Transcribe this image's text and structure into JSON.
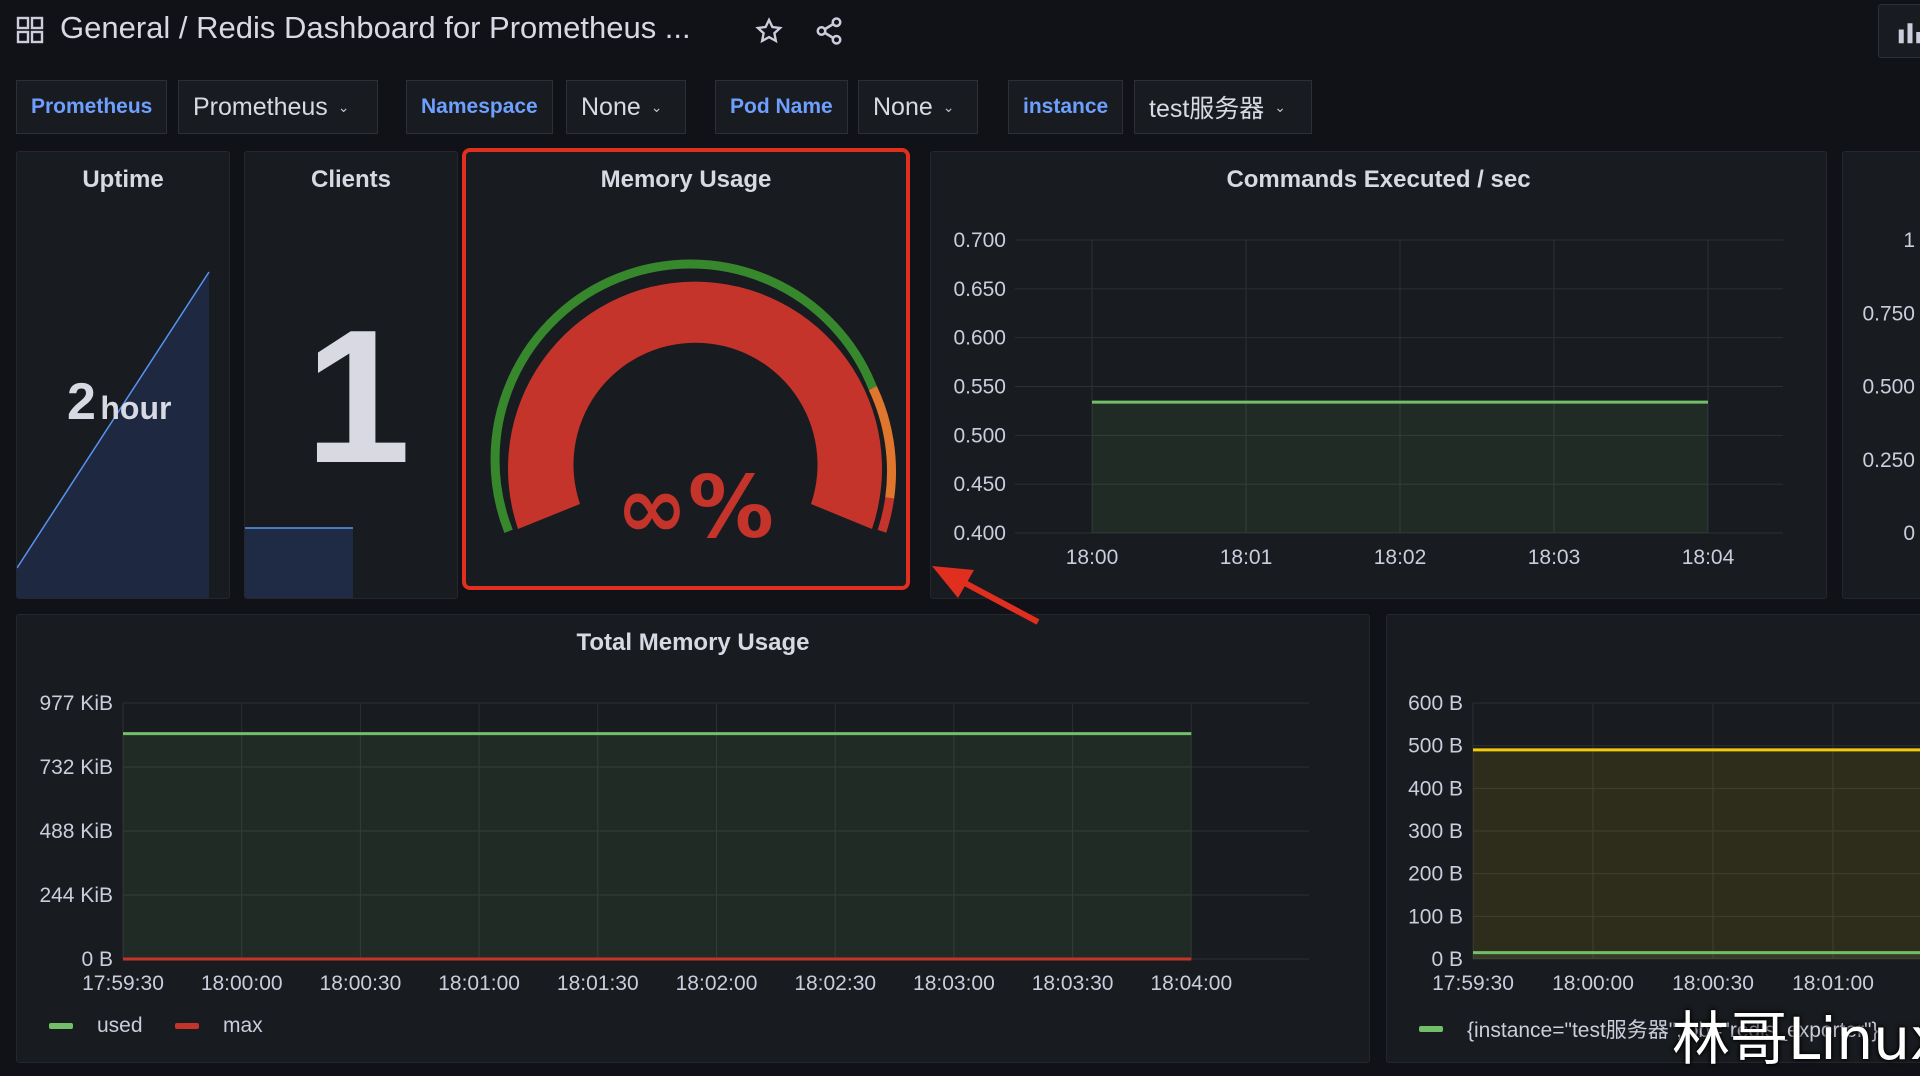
{
  "topbar": {
    "breadcrumb": "General  / Redis Dashboard for Prometheus ...",
    "icons": [
      "grid-icon",
      "star-icon",
      "share-icon",
      "panel-add-icon"
    ]
  },
  "variables": [
    {
      "label": "Prometheus",
      "value": "Prometheus"
    },
    {
      "label": "Namespace",
      "value": "None"
    },
    {
      "label": "Pod Name",
      "value": "None"
    },
    {
      "label": "instance",
      "value": "test服务器"
    }
  ],
  "uptime": {
    "title": "Uptime",
    "value": "2",
    "unit": "hour"
  },
  "clients": {
    "title": "Clients",
    "value": "1"
  },
  "memory_usage": {
    "title": "Memory Usage",
    "value": "∞%",
    "colors": {
      "track_green": "#37872d",
      "fill_red": "#c4342b",
      "orange": "#e0752d",
      "highlight": "#e02f1f"
    }
  },
  "commands": {
    "title": "Commands Executed / sec",
    "chart_data": {
      "type": "line",
      "x": [
        "18:00",
        "18:01",
        "18:02",
        "18:03",
        "18:04"
      ],
      "y_ticks": [
        "0.700",
        "0.650",
        "0.600",
        "0.550",
        "0.500",
        "0.450",
        "0.400"
      ],
      "ylim": [
        0.4,
        0.7
      ],
      "series": [
        {
          "values": [
            0.534,
            0.534,
            0.534,
            0.534,
            0.534
          ],
          "color": "#73bf69"
        }
      ]
    }
  },
  "right_partial": {
    "y_ticks": [
      "1",
      "0.750",
      "0.500",
      "0.250",
      "0"
    ]
  },
  "total_memory": {
    "title": "Total Memory Usage",
    "chart_data": {
      "type": "line",
      "x": [
        "17:59:30",
        "18:00:00",
        "18:00:30",
        "18:01:00",
        "18:01:30",
        "18:02:00",
        "18:02:30",
        "18:03:00",
        "18:03:30",
        "18:04:00"
      ],
      "y_ticks": [
        "977 KiB",
        "732 KiB",
        "488 KiB",
        "244 KiB",
        "0 B"
      ],
      "ylim": [
        0,
        977
      ],
      "series": [
        {
          "name": "used",
          "values": [
            860,
            860,
            860,
            860,
            860,
            860,
            860,
            860,
            860,
            860
          ],
          "color": "#73bf69"
        },
        {
          "name": "max",
          "values": [
            0,
            0,
            0,
            0,
            0,
            0,
            0,
            0,
            0,
            0
          ],
          "color": "#c4342b"
        }
      ]
    }
  },
  "bottom_right": {
    "chart_data": {
      "type": "line",
      "x": [
        "17:59:30",
        "18:00:00",
        "18:00:30",
        "18:01:00"
      ],
      "y_ticks": [
        "600 B",
        "500 B",
        "400 B",
        "300 B",
        "200 B",
        "100 B",
        "0 B"
      ],
      "ylim": [
        0,
        600
      ],
      "series": [
        {
          "values": [
            490,
            490,
            490,
            490
          ],
          "color": "#f2cc0c"
        },
        {
          "name": "{instance=\"test服务器\",job=\"redis_exporter\"}",
          "values": [
            15,
            15,
            15,
            15
          ],
          "color": "#73bf69"
        }
      ]
    },
    "legend": "{instance=\"test服务器\",job=\"redis_exporter\"}"
  },
  "watermark": "林哥Linux"
}
